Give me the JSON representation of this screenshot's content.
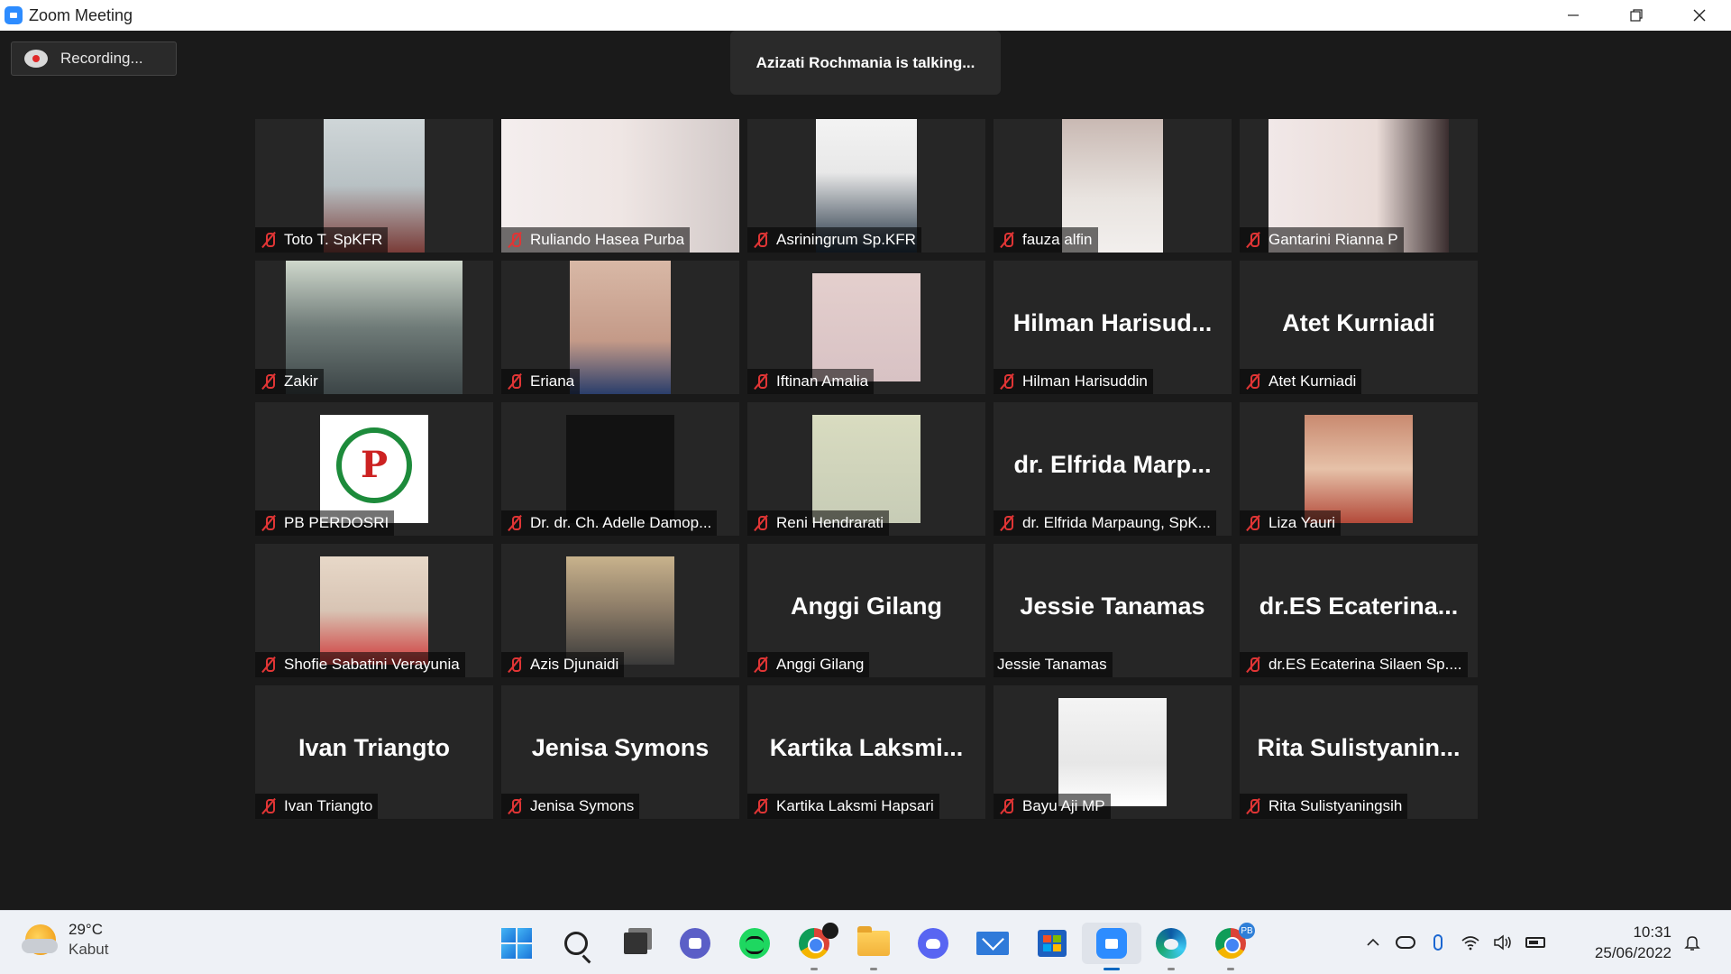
{
  "window": {
    "title": "Zoom Meeting",
    "minimize_icon": "minimize-icon",
    "maximize_icon": "restore-icon",
    "close_icon": "close-icon"
  },
  "meeting": {
    "recording_label": "Recording...",
    "talking_banner": "Azizati Rochmania is talking...",
    "participants": [
      {
        "name": "Toto T. SpKFR",
        "video": true
      },
      {
        "name": "Ruliando Hasea Purba",
        "video": true
      },
      {
        "name": "Asriningrum Sp.KFR",
        "video": true
      },
      {
        "name": "fauza alfin",
        "video": true
      },
      {
        "name": "Gantarini Rianna P",
        "video": true
      },
      {
        "name": "Zakir",
        "video": true
      },
      {
        "name": "Eriana",
        "video": true
      },
      {
        "name": "Iftinan Amalia",
        "video": true
      },
      {
        "name": "Hilman Harisuddin",
        "display_name": "Hilman Harisud...",
        "video": false
      },
      {
        "name": "Atet Kurniadi",
        "display_name": "Atet Kurniadi",
        "video": false
      },
      {
        "name": "PB PERDOSRI",
        "video": true,
        "logo_text": "PERDOSRI"
      },
      {
        "name": "Dr. dr. Ch. Adelle Damop...",
        "video": true
      },
      {
        "name": "Reni Hendrarati",
        "video": true
      },
      {
        "name": "dr. Elfrida Marpaung, SpK...",
        "display_name": "dr. Elfrida Marp...",
        "video": false
      },
      {
        "name": "Liza Yauri",
        "video": true
      },
      {
        "name": "Shofie Sabatini Verayunia",
        "video": true
      },
      {
        "name": "Azis Djunaidi",
        "video": true
      },
      {
        "name": "Anggi Gilang",
        "display_name": "Anggi Gilang",
        "video": false
      },
      {
        "name": "Jessie Tanamas",
        "display_name": "Jessie Tanamas",
        "video": false,
        "unmuted": true
      },
      {
        "name": "dr.ES Ecaterina Silaen Sp....",
        "display_name": "dr.ES Ecaterina...",
        "video": false
      },
      {
        "name": "Ivan Triangto",
        "display_name": "Ivan Triangto",
        "video": false
      },
      {
        "name": "Jenisa Symons",
        "display_name": "Jenisa Symons",
        "video": false
      },
      {
        "name": "Kartika Laksmi Hapsari",
        "display_name": "Kartika Laksmi...",
        "video": false
      },
      {
        "name": "Bayu Aji MP",
        "video": true
      },
      {
        "name": "Rita Sulistyaningsih",
        "display_name": "Rita Sulistyanin...",
        "video": false
      }
    ]
  },
  "taskbar": {
    "weather": {
      "temp": "29°C",
      "condition": "Kabut",
      "icon": "partly-cloudy-icon"
    },
    "apps": [
      {
        "name": "start",
        "icon": "windows-start-icon"
      },
      {
        "name": "search",
        "icon": "search-icon"
      },
      {
        "name": "task-view",
        "icon": "task-view-icon"
      },
      {
        "name": "teams",
        "icon": "teams-chat-icon"
      },
      {
        "name": "spotify",
        "icon": "spotify-icon"
      },
      {
        "name": "chrome",
        "icon": "chrome-icon"
      },
      {
        "name": "file-explorer",
        "icon": "folder-icon"
      },
      {
        "name": "discord",
        "icon": "discord-icon"
      },
      {
        "name": "mail",
        "icon": "mail-icon"
      },
      {
        "name": "store",
        "icon": "microsoft-store-icon"
      },
      {
        "name": "zoom",
        "icon": "zoom-icon",
        "active": true
      },
      {
        "name": "edge",
        "icon": "edge-icon"
      },
      {
        "name": "chrome-profile",
        "icon": "chrome-icon",
        "badge": "PB"
      }
    ],
    "tray": [
      "chevron-up-icon",
      "onedrive-cloud-icon",
      "microphone-icon",
      "wifi-icon",
      "volume-icon",
      "battery-icon"
    ],
    "clock": {
      "time": "10:31",
      "date": "25/06/2022"
    },
    "notification_icon": "notification-icon"
  }
}
